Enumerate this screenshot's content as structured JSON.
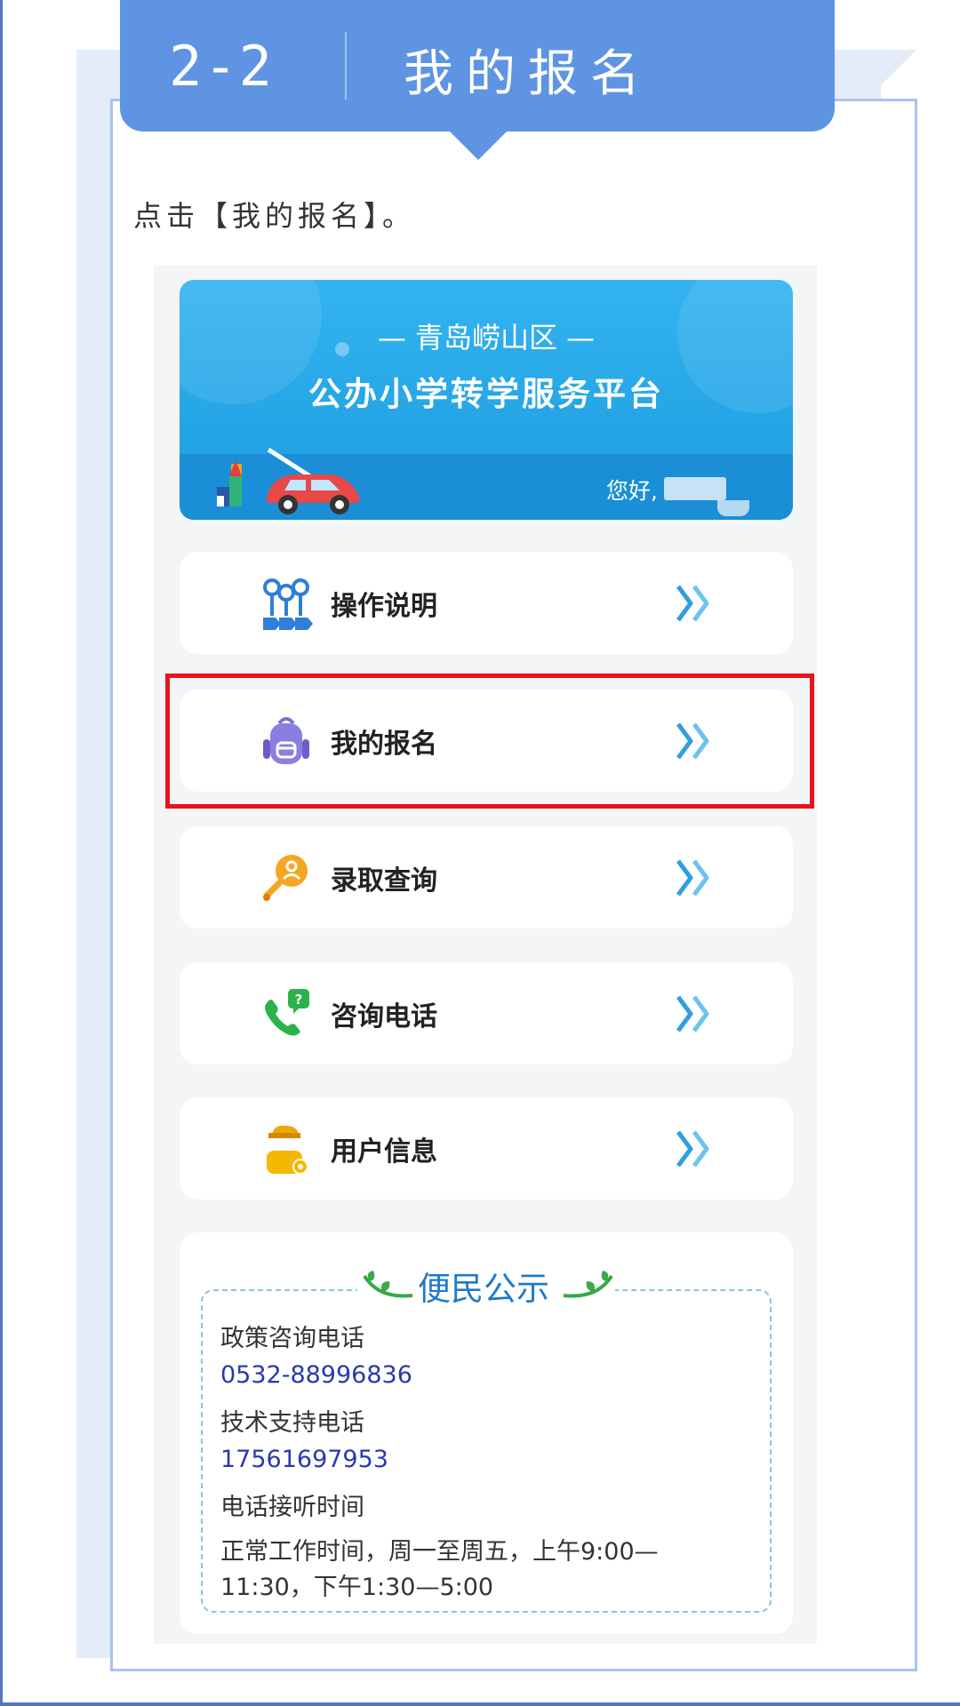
{
  "section": {
    "number": "2-2",
    "title": "我的报名"
  },
  "instruction": "点击【我的报名】。",
  "banner": {
    "subtitle": "— 青岛崂山区 —",
    "title": "公办小学转学服务平台",
    "greeting": "您好,"
  },
  "menu": [
    {
      "label": "操作说明",
      "icon": "guide-icon"
    },
    {
      "label": "我的报名",
      "icon": "backpack-icon",
      "highlighted": true
    },
    {
      "label": "录取查询",
      "icon": "search-person-icon"
    },
    {
      "label": "咨询电话",
      "icon": "phone-question-icon"
    },
    {
      "label": "用户信息",
      "icon": "user-card-icon"
    }
  ],
  "notice": {
    "title": "便民公示",
    "policy_label": "政策咨询电话",
    "policy_phone": "0532-88996836",
    "tech_label": "技术支持电话",
    "tech_phone": "17561697953",
    "hours_label": "电话接听时间",
    "hours_line1": "正常工作时间，周一至周五，上午9:00—",
    "hours_line2": "11:30，下午1:30—5:00"
  },
  "colors": {
    "header_blue": "#5e94e2",
    "banner_blue": "#1c9bde",
    "highlight_red": "#e8141b",
    "arrow_blue": "#2f9fe0",
    "phone_text": "#2a3aa8"
  }
}
